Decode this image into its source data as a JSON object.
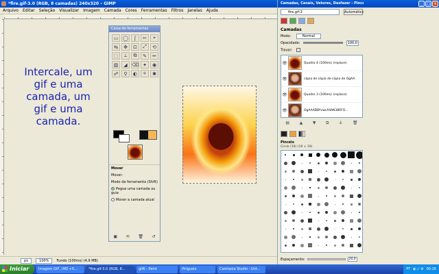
{
  "main_window": {
    "title": "*fire.gif-3.0 (RGB, 8 camadas) 240x320 – GIMP",
    "menu": [
      "Arquivo",
      "Editar",
      "Seleção",
      "Visualizar",
      "Imagem",
      "Camada",
      "Cores",
      "Ferramentas",
      "Filtros",
      "Janelas",
      "Ajuda"
    ]
  },
  "caption": "Intercale, um gif e uma camada, um gif e uma camada.",
  "statusbar": {
    "unit": "px",
    "zoom": "100%",
    "info": "Fundo (100ms) (4,9 MB)"
  },
  "toolbox": {
    "title": "Caixa de ferramentas",
    "tools": [
      "▭",
      "◯",
      "ʃ",
      "✂",
      "⌖",
      "⇆",
      "✥",
      "⊡",
      "⤢",
      "⟲",
      "⬚",
      "⟂",
      "⧉",
      "✎",
      "✏",
      "▨",
      "◢",
      "⌫",
      "✦",
      "◉",
      "☍",
      "⚲",
      "◐",
      "⟡",
      "✱"
    ],
    "options_title": "Mover",
    "options_move": "Mover:",
    "tool_mode_label": "Modo da ferramenta (Shift)",
    "option1": "Pegue uma camada ou guia",
    "option2": "Mover a camada atual"
  },
  "dock": {
    "title": "Camadas, Canais, Vetores, Desfazer - Pincéi...",
    "image_select": "fire.gif-3",
    "auto_label": "Automático",
    "layers_label": "Camadas",
    "mode_label": "Modo:",
    "mode_value": "Normal",
    "opacity_label": "Opacidade:",
    "opacity_value": "100,0",
    "lock_label": "Travar:",
    "layers": [
      {
        "name": "Quadro 4 (100ms) (replace)",
        "face": false
      },
      {
        "name": "cópia de cópia de cópia de OgAA",
        "face": true
      },
      {
        "name": "Quadro 3 (100ms) (replace)",
        "face": false
      },
      {
        "name": "OgAAABBYvwcAllAN38RFO...",
        "face": true
      }
    ],
    "brushes_label": "Pincéis",
    "brush_sub": "Circle (19) (19 × 19)",
    "spacing_label": "Espaçamento:",
    "spacing_value": "20,0"
  },
  "taskbar": {
    "start": "Iniciar",
    "tasks": [
      "Imagem GIF, (HD +5...",
      "*fire.gif-3.0 (RGB, 8...",
      "gif6 - Paint",
      "Pirigueix",
      "Camtasia Studio - Unt..."
    ],
    "lang": "PT",
    "time": "00:26"
  }
}
